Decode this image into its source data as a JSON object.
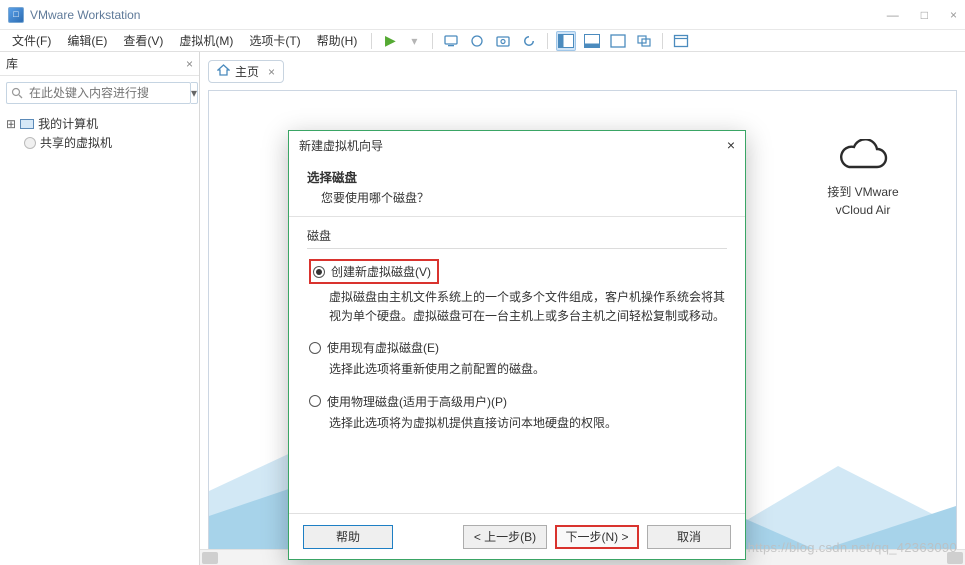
{
  "window": {
    "title": "VMware Workstation",
    "controls": {
      "min": "—",
      "max": "□",
      "close": "×"
    }
  },
  "menu": {
    "items": [
      "文件(F)",
      "编辑(E)",
      "查看(V)",
      "虚拟机(M)",
      "选项卡(T)",
      "帮助(H)"
    ]
  },
  "sidebar": {
    "title": "库",
    "close": "×",
    "search_placeholder": "在此处键入内容进行搜",
    "tree": {
      "my_pc": "我的计算机",
      "shared": "共享的虚拟机"
    }
  },
  "home_tab": {
    "label": "主页",
    "close": "×"
  },
  "cloud": {
    "line1": "接到 VMware",
    "line2": "vCloud Air"
  },
  "dialog": {
    "title": "新建虚拟机向导",
    "close": "×",
    "heading": "选择磁盘",
    "subheading": "您要使用哪个磁盘？",
    "group_label": "磁盘",
    "opt1": {
      "label": "创建新虚拟磁盘(V)",
      "desc": "虚拟磁盘由主机文件系统上的一个或多个文件组成，客户机操作系统会将其视为单个硬盘。虚拟磁盘可在一台主机上或多台主机之间轻松复制或移动。"
    },
    "opt2": {
      "label": "使用现有虚拟磁盘(E)",
      "desc": "选择此选项将重新使用之前配置的磁盘。"
    },
    "opt3": {
      "label": "使用物理磁盘(适用于高级用户)(P)",
      "desc": "选择此选项将为虚拟机提供直接访问本地硬盘的权限。"
    },
    "buttons": {
      "help": "帮助",
      "back": "< 上一步(B)",
      "next": "下一步(N) >",
      "cancel": "取消"
    }
  },
  "watermark": "https://blog.csdn.net/qq_42363090"
}
